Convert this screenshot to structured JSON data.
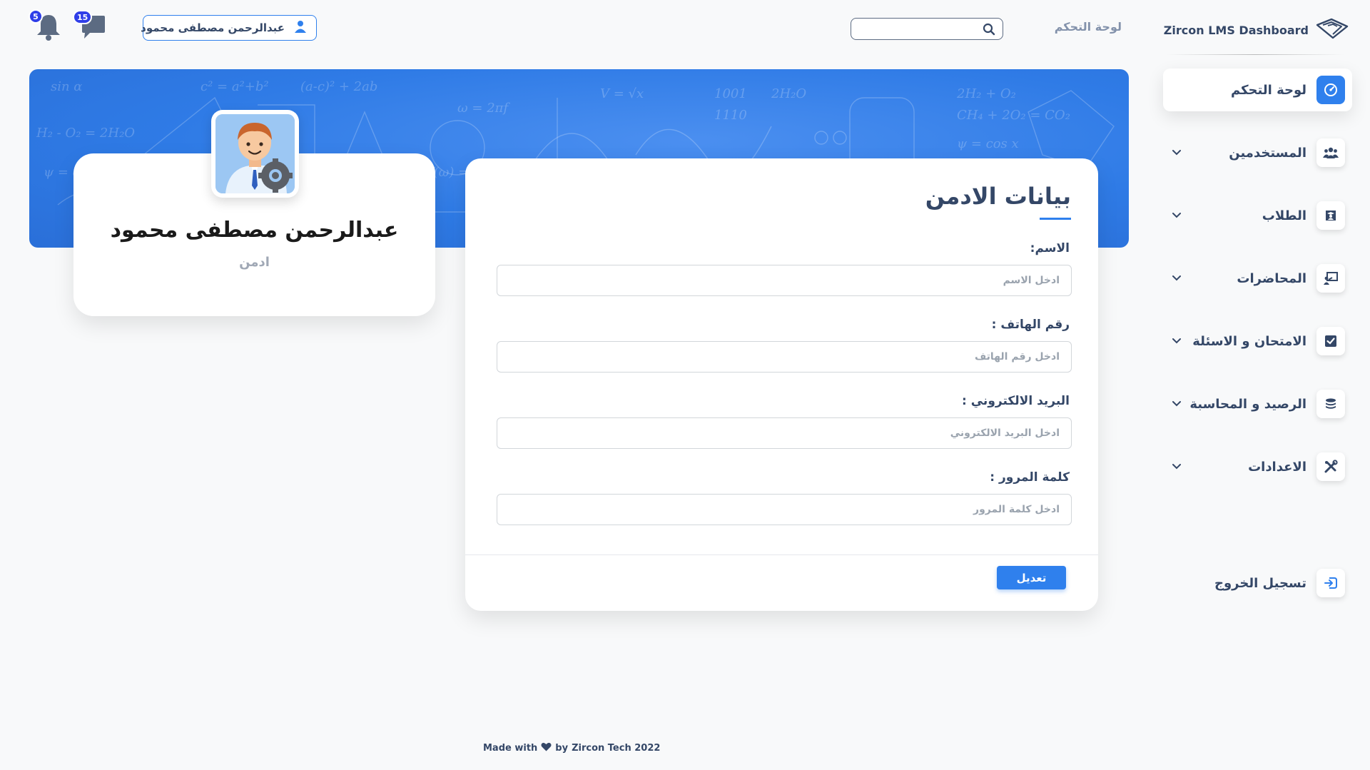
{
  "brand": {
    "name": "Zircon LMS Dashboard"
  },
  "topbar": {
    "breadcrumb": "لوحة التحكم",
    "search_placeholder": "",
    "user_name": "عبدالرحمن مصطفى محمود",
    "notifications_count": "5",
    "messages_count": "15"
  },
  "sidebar": {
    "items": [
      {
        "label": "لوحة التحكم",
        "icon": "dashboard-icon",
        "active": true
      },
      {
        "label": "المستخدمين",
        "icon": "users-icon",
        "active": false
      },
      {
        "label": "الطلاب",
        "icon": "student-icon",
        "active": false
      },
      {
        "label": "المحاضرات",
        "icon": "lecture-icon",
        "active": false
      },
      {
        "label": "الامتحان و الاسئلة",
        "icon": "exam-icon",
        "active": false
      },
      {
        "label": "الرصيد و المحاسبة",
        "icon": "coins-icon",
        "active": false
      },
      {
        "label": "الاعدادات",
        "icon": "tools-icon",
        "active": false
      }
    ],
    "logout_label": "تسجيل الخروج"
  },
  "profile": {
    "name": "عبدالرحمن مصطفى محمود",
    "role": "ادمن"
  },
  "form": {
    "title": "بيانات الادمن",
    "fields": [
      {
        "label": "الاسم:",
        "placeholder": "ادخل الاسم",
        "value": ""
      },
      {
        "label": "رقم الهاتف :",
        "placeholder": "ادخل رقم الهاتف",
        "value": ""
      },
      {
        "label": "البريد الالكتروني :",
        "placeholder": "ادخل البريد الالكتروني",
        "value": ""
      },
      {
        "label": "كلمة المرور :",
        "placeholder": "ادخل كلمة المرور",
        "value": ""
      }
    ],
    "submit_label": "تعديل"
  },
  "footer": {
    "made_with": "Made with",
    "by": "by",
    "company": "Zircon Tech 2022"
  },
  "colors": {
    "accent": "#2f80ed",
    "badge": "#2f3ee8",
    "text": "#344767",
    "muted": "#8392ab"
  }
}
